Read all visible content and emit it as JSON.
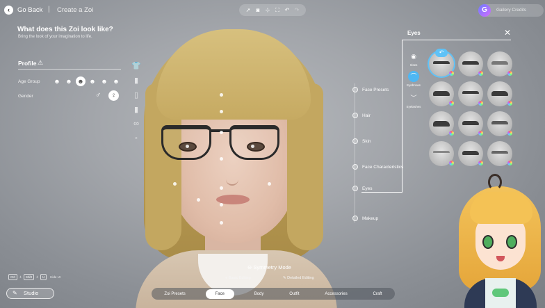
{
  "header": {
    "back_label": "Go Back",
    "separator": "|",
    "breadcrumb": "Create a Zoi",
    "toolbar_icons": [
      "rocket-icon",
      "camera-icon",
      "focus-icon",
      "expand-icon",
      "undo-icon",
      "redo-icon"
    ],
    "currency_label": "Gallery Credits"
  },
  "left_panel": {
    "question": "What does this Zoi look like?",
    "subtext": "Bring the look of your imagination to life.",
    "profile_title": "Profile",
    "profile_warning_icon": "warning-icon",
    "age_group_label": "Age Group",
    "age_group_options": [
      "child",
      "teen",
      "young-adult",
      "adult",
      "middle-aged",
      "elder"
    ],
    "age_group_selected": "young-adult",
    "gender_label": "Gender",
    "gender_options": [
      "male",
      "female"
    ],
    "gender_selected": "female",
    "outfit_slots": [
      "top",
      "bottom",
      "shoes",
      "socks",
      "glasses",
      "accessory"
    ]
  },
  "categories": [
    {
      "label": "Face Presets"
    },
    {
      "label": "Hair"
    },
    {
      "label": "Skin"
    },
    {
      "label": "Face Characteristics"
    },
    {
      "label": "Eyes"
    },
    {
      "label": "Makeup"
    }
  ],
  "eyes_panel": {
    "title": "Eyes",
    "close_icon": "close-icon",
    "sub_tabs": [
      {
        "label": "Irises",
        "icon": "iris-icon"
      },
      {
        "label": "Eyebrows",
        "icon": "eyebrow-icon",
        "selected": true
      },
      {
        "label": "Eyelashes",
        "icon": "eyelash-icon"
      }
    ],
    "eyebrow_presets_count": 12,
    "eyebrow_selected_index": 0,
    "undo_icon": "undo-icon"
  },
  "bottom": {
    "symmetry_label": "Symmetry Mode",
    "basic_editing": "Basic Editing",
    "detailed_editing": "Detailed Editing",
    "tabs": [
      "Zoi Presets",
      "Face",
      "Body",
      "Outfit",
      "Accessories",
      "Craft"
    ],
    "active_tab": "Face",
    "shortcut_keys": [
      "Ctrl",
      "Shift",
      "U"
    ],
    "shortcut_label": "Hide UI",
    "studio_label": "Studio"
  },
  "colors": {
    "accent": "#5fc2f7",
    "background": "#9ea2a7"
  }
}
